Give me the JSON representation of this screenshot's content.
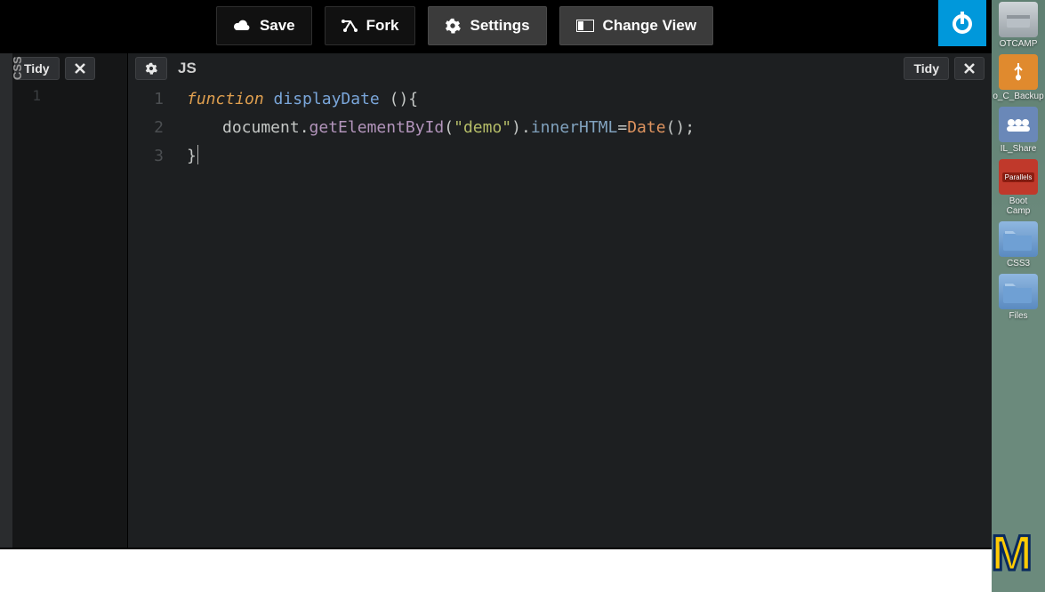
{
  "toolbar": {
    "save": "Save",
    "fork": "Fork",
    "settings": "Settings",
    "change_view": "Change View"
  },
  "css_pane": {
    "handle_label": "CSS",
    "tidy": "Tidy",
    "line_1": "1"
  },
  "js_pane": {
    "lang": "JS",
    "tidy": "Tidy",
    "lines": [
      "1",
      "2",
      "3"
    ],
    "code": {
      "l1_kw": "function",
      "l1_name": "displayDate",
      "l1_paren": "(){",
      "l2_obj": "document",
      "l2_dot1": ".",
      "l2_method": "getElementById",
      "l2_open": "(",
      "l2_str": "\"demo\"",
      "l2_close": ")",
      "l2_dot2": ".",
      "l2_prop": "innerHTML",
      "l2_eq": "=",
      "l2_call": "Date",
      "l2_call_p": "();",
      "l3": "}"
    }
  },
  "desktop": {
    "bootcamp_hd": "OTCAMP",
    "usb": "o_C_Backup",
    "share": "IL_Share",
    "parallels_badge": "Parallels",
    "parallels": "Boot Camp",
    "css3": "CSS3",
    "files": "Files"
  },
  "logo": "M"
}
